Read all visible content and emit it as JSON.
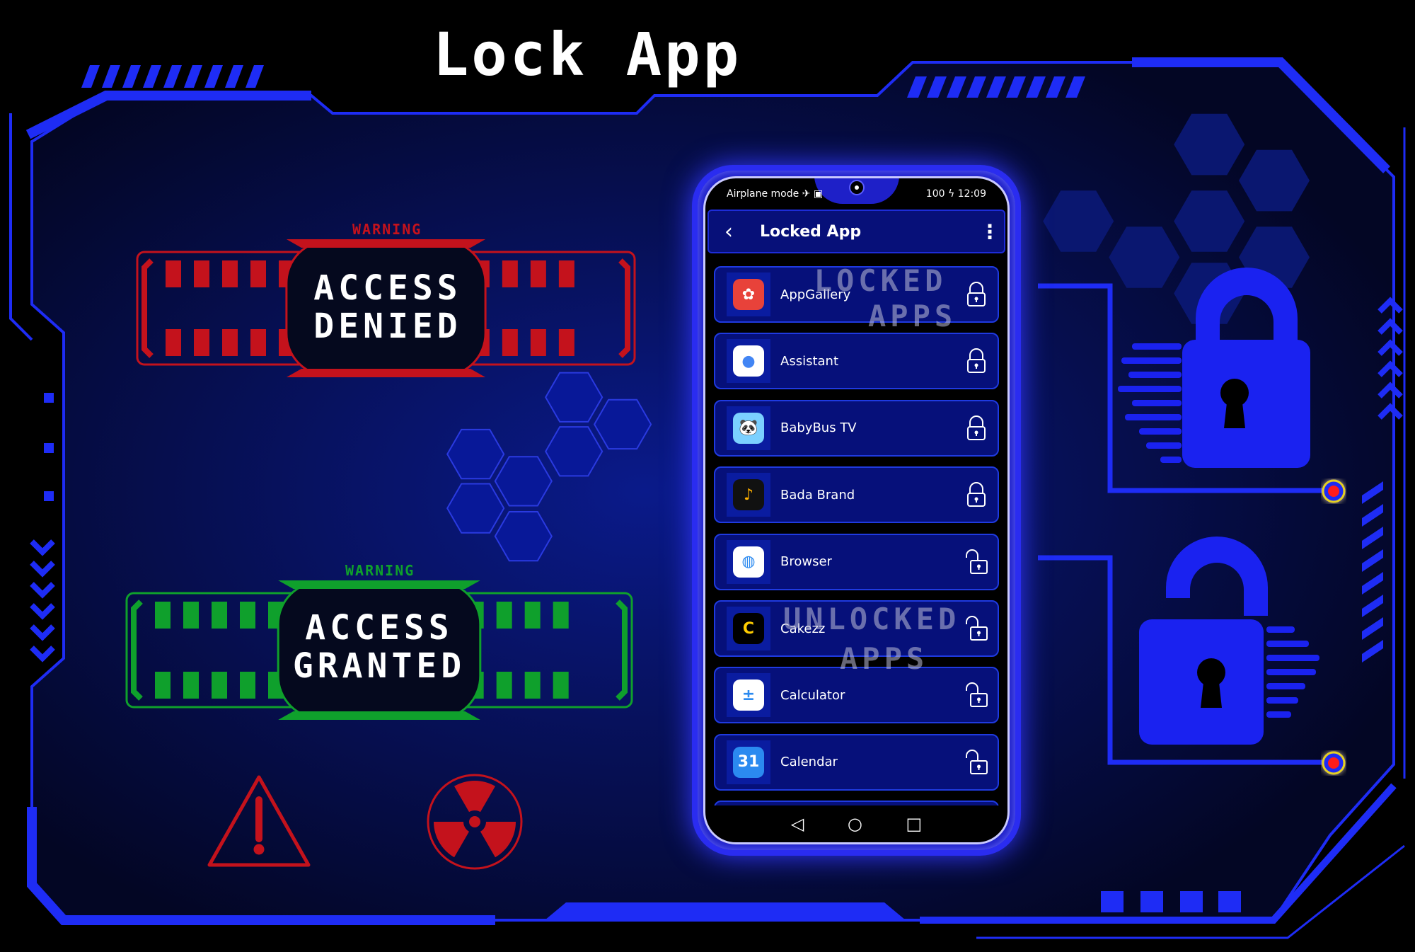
{
  "title": "Lock App",
  "colors": {
    "frame": "#1e2cf5",
    "background": "#04082f",
    "denied": "#c4121c",
    "granted": "#0fa02c",
    "hex": "#0a1aa8",
    "dot": "#ff1c1c"
  },
  "denied_panel": {
    "warning": "WARNING",
    "line1": "ACCESS",
    "line2": "DENIED"
  },
  "granted_panel": {
    "warning": "WARNING",
    "line1": "ACCESS",
    "line2": "GRANTED"
  },
  "icons": {
    "hazard": "warning-triangle-icon",
    "radiation": "radiation-icon",
    "locked": "padlock-closed-icon",
    "unlocked": "padlock-open-icon"
  },
  "phone": {
    "status_left": "Airplane mode ✈ ▣",
    "status_right": "100 ϟ 12:09",
    "header_title": "Locked App",
    "back": "‹",
    "more": "⋮",
    "watermark_locked": [
      "LOCKED",
      "APPS"
    ],
    "watermark_unlocked": [
      "UNLOCKED",
      "APPS"
    ],
    "apps": [
      {
        "name": "AppGallery",
        "locked": true,
        "icon": "✿",
        "bg": "#e8423a",
        "fg": "#fff"
      },
      {
        "name": "Assistant",
        "locked": true,
        "icon": "●",
        "bg": "#ffffff",
        "fg": "#4285f4"
      },
      {
        "name": "BabyBus TV",
        "locked": true,
        "icon": "🐼",
        "bg": "#7bd0ff",
        "fg": "#fff"
      },
      {
        "name": "Bada Brand",
        "locked": true,
        "icon": "♪",
        "bg": "#111111",
        "fg": "#ffb000"
      },
      {
        "name": "Browser",
        "locked": false,
        "icon": "◍",
        "bg": "#ffffff",
        "fg": "#2b8af0"
      },
      {
        "name": "Cakezz",
        "locked": false,
        "icon": "C",
        "bg": "#000000",
        "fg": "#ffcc00"
      },
      {
        "name": "Calculator",
        "locked": false,
        "icon": "±",
        "bg": "#ffffff",
        "fg": "#2b8af0"
      },
      {
        "name": "Calendar",
        "locked": false,
        "icon": "31",
        "bg": "#2b8af0",
        "fg": "#fff"
      },
      {
        "name": "",
        "locked": false,
        "icon": "",
        "bg": "#ffffff",
        "fg": "#fff"
      }
    ],
    "nav": {
      "back": "◁",
      "home": "○",
      "recents": "□"
    }
  }
}
